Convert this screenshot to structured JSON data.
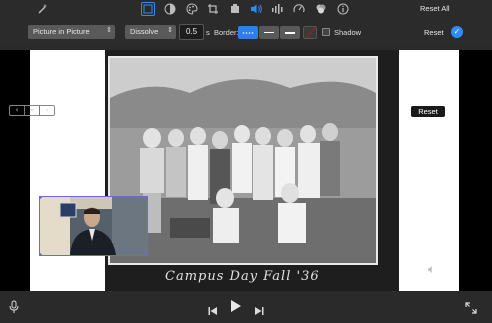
{
  "toolbar": {
    "reset_all_label": "Reset All",
    "icons": [
      "magic-wand",
      "crop-frame",
      "color-balance",
      "color-palette",
      "crop",
      "stabilization-camera",
      "volume",
      "noise-reduction",
      "speed",
      "clip-filter",
      "info"
    ]
  },
  "overlay_options": {
    "overlay_mode": "Picture in Picture",
    "transition": "Dissolve",
    "duration": "0.5",
    "duration_unit": "s",
    "border_label": "Border:",
    "shadow_label": "Shadow",
    "reset_label": "Reset"
  },
  "viewer": {
    "reset_button_label": "Reset",
    "caption": "Campus Day  Fall '36"
  },
  "colors": {
    "accent": "#2f8cff",
    "pip_handle": "#6f63d9"
  }
}
